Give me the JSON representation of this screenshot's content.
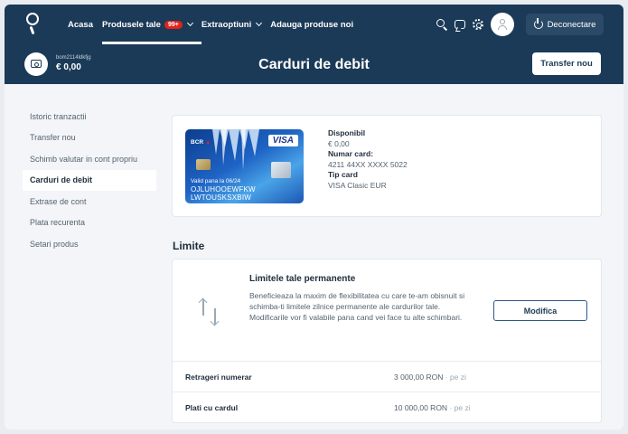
{
  "nav": {
    "items": [
      {
        "label": "Acasa"
      },
      {
        "label": "Produsele tale",
        "badge": "99+"
      },
      {
        "label": "Extraoptiuni"
      },
      {
        "label": "Adauga produse noi"
      }
    ],
    "logout_label": "Deconectare"
  },
  "account": {
    "name": "bom2114ldkfjg",
    "balance": "€ 0,00"
  },
  "page_title": "Carduri de debit",
  "transfer_button": "Transfer nou",
  "sidebar": {
    "items": [
      {
        "label": "Istoric tranzactii"
      },
      {
        "label": "Transfer nou"
      },
      {
        "label": "Schimb valutar in cont propriu"
      },
      {
        "label": "Carduri de debit",
        "active": true
      },
      {
        "label": "Extrase de cont"
      },
      {
        "label": "Plata recurenta"
      },
      {
        "label": "Setari produs"
      }
    ]
  },
  "card": {
    "bank": "BCR",
    "network": "VISA",
    "valid_until": "Valid pana la 06/24",
    "name_line1": "OJLUHOOEWFKW",
    "name_line2": "LWTOUSKSXBIW",
    "available_label": "Disponibil",
    "available_value": "€ 0,00",
    "number_label": "Numar card:",
    "number_value": "4211 44XX XXXX 5022",
    "type_label": "Tip card",
    "type_value": "VISA Clasic EUR"
  },
  "limits": {
    "section_title": "Limite",
    "heading": "Limitele tale permanente",
    "description": "Beneficieaza la maxim de flexibilitatea cu care te-am obisnuit si schimba-ti limitele zilnice permanente ale cardurilor tale. Modificarile vor fi valabile pana cand vei face tu alte schimbari.",
    "modify_button": "Modifica",
    "rows": [
      {
        "label": "Retrageri numerar",
        "value": "3 000,00 RON",
        "period": "· pe zi"
      },
      {
        "label": "Plati cu cardul",
        "value": "10 000,00 RON",
        "period": "· pe zi"
      }
    ]
  },
  "colors": {
    "navy": "#1b3a57",
    "badge_red": "#e2231a",
    "page_bg": "#f3f5f8"
  }
}
